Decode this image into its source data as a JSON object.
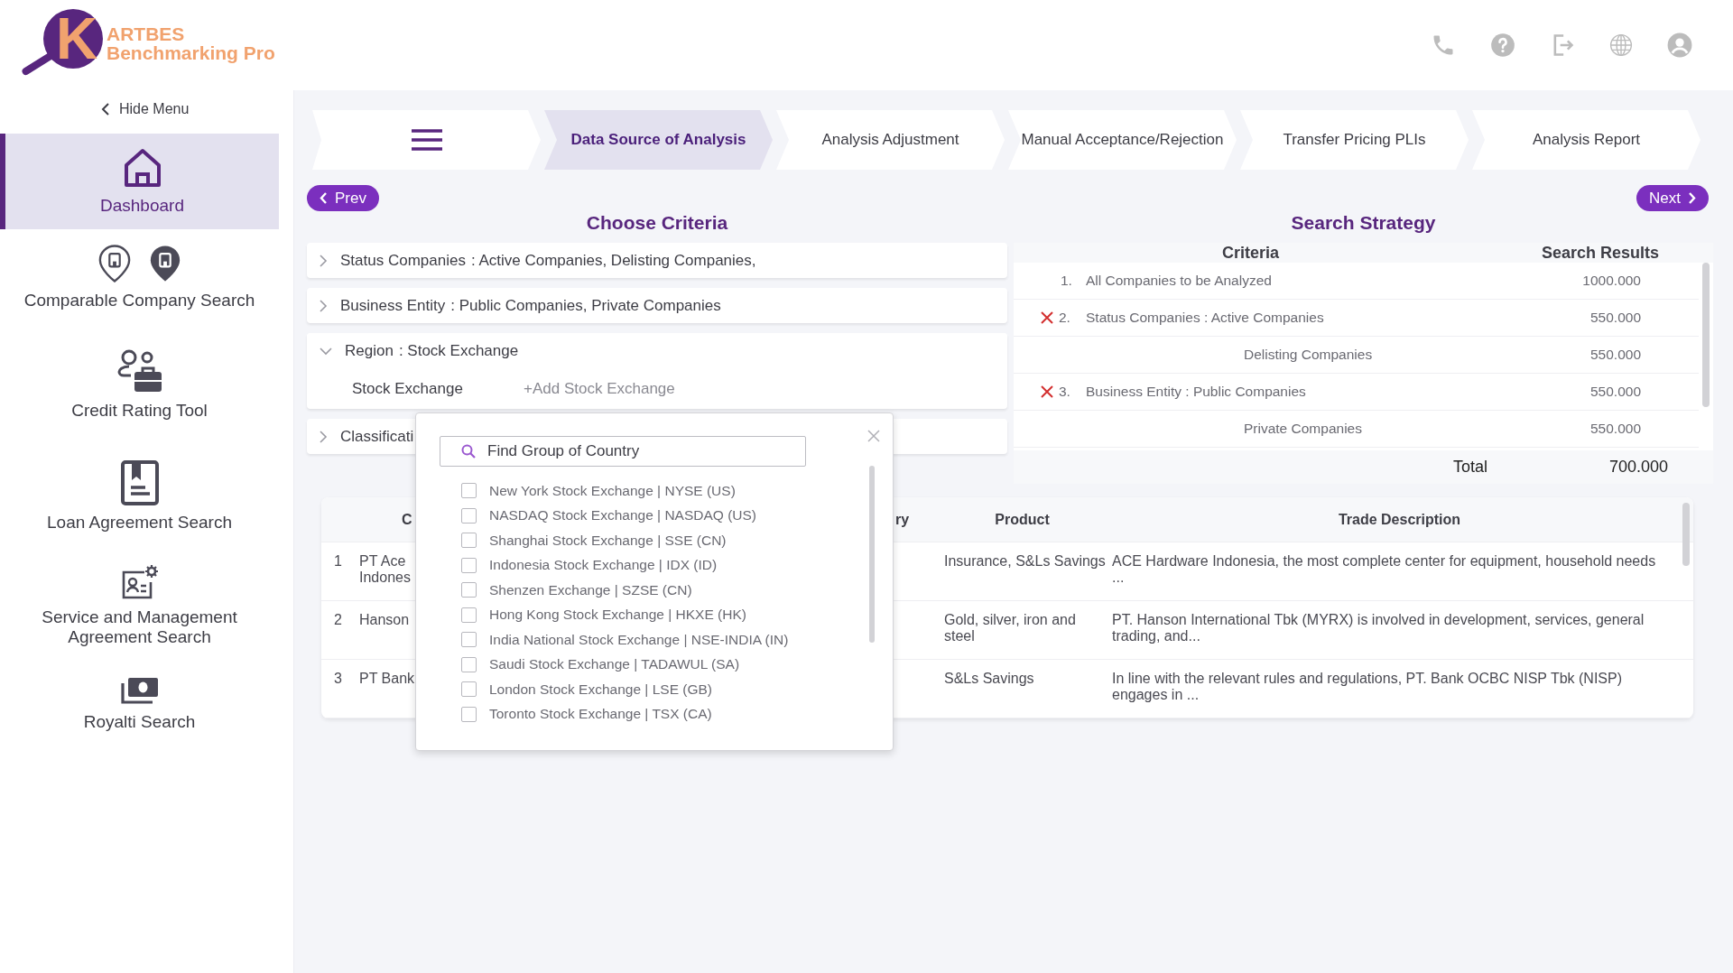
{
  "logo": {
    "mark": "K",
    "name": "ARTBES",
    "subtitle": "Benchmarking Pro"
  },
  "header_icons": [
    {
      "kind": "phone"
    },
    {
      "kind": "help"
    },
    {
      "kind": "logout"
    },
    {
      "kind": "globe"
    },
    {
      "kind": "user"
    }
  ],
  "sidebar": {
    "hide_menu": "Hide Menu",
    "items": [
      {
        "label": "Dashboard",
        "kind": "home",
        "selected": true
      },
      {
        "label": "Comparable Company Search",
        "kind": "pins",
        "selected": false
      },
      {
        "label": "Credit Rating Tool",
        "kind": "person-briefcase",
        "selected": false
      },
      {
        "label": "Loan Agreement Search",
        "kind": "document",
        "selected": false
      },
      {
        "label": "Service and Management Agreement Search",
        "kind": "profile-gear",
        "selected": false
      },
      {
        "label": "Royalti Search",
        "kind": "cash",
        "selected": false
      }
    ]
  },
  "tabs": [
    {
      "kind": "menu",
      "selected": false
    },
    {
      "kind": "step",
      "label": "Data Source of Analysis",
      "selected": true
    },
    {
      "kind": "step",
      "label": "Analysis Adjustment",
      "selected": false
    },
    {
      "kind": "step",
      "label": "Manual Acceptance/Rejection",
      "selected": false
    },
    {
      "kind": "step",
      "label": "Transfer Pricing PLIs",
      "selected": false
    },
    {
      "kind": "step",
      "label": "Analysis Report",
      "selected": false
    }
  ],
  "prev_button": "Prev",
  "next_button": "Next",
  "criteria": {
    "title": "Choose Criteria",
    "rows": [
      {
        "label": "Status Companies",
        "value": ": Active Companies,  Delisting Companies,",
        "expanded": false
      },
      {
        "label": "Business Entity",
        "value": ": Public Companies,  Private Companies",
        "expanded": false
      },
      {
        "label": "Region",
        "value": ": Stock Exchange",
        "expanded": true,
        "children": [
          {
            "label": "Stock Exchange",
            "action": "+Add Stock Exchange"
          }
        ]
      },
      {
        "label": "Classificati",
        "expanded": false
      }
    ]
  },
  "strategy": {
    "title": "Search Strategy",
    "columns": [
      "Criteria",
      "Search Results"
    ],
    "rows": [
      {
        "number": "1.",
        "criteria": "All Companies to be Analyzed",
        "result": "1000.000",
        "removable": false
      },
      {
        "number": "2.",
        "criteria": "Status Companies : Active Companies",
        "result": "550.000",
        "removable": true
      },
      {
        "criteria": "Delisting Companies",
        "result": "550.000",
        "removable": false
      },
      {
        "number": "3.",
        "criteria": "Business Entity : Public Companies",
        "result": "550.000",
        "removable": true
      },
      {
        "criteria": "Private Companies",
        "result": "550.000",
        "removable": false
      }
    ],
    "total_label": "Total",
    "total": "700.000"
  },
  "companies": {
    "columns": [
      "C",
      "ry",
      "Product",
      "Trade Description"
    ],
    "rows": [
      {
        "number": "1",
        "company": "PT Ace\nIndones",
        "product": "Insurance, S&Ls Savings",
        "trade_description": "ACE Hardware Indonesia, the most complete center for equipment, household needs ..."
      },
      {
        "number": "2",
        "company": "Hanson",
        "product": "Gold, silver, iron and steel",
        "trade_description": "PT. Hanson International Tbk (MYRX) is involved in development, services, general trading, and..."
      },
      {
        "number": "3",
        "company": "PT Bank",
        "product": "S&Ls Savings",
        "trade_description": "In line with the relevant rules and regulations, PT. Bank OCBC NISP Tbk (NISP) engages in ..."
      }
    ]
  },
  "exchange_popup": {
    "search": {
      "placeholder": "Find Group of Country"
    },
    "options": [
      {
        "label": "New York Stock Exchange | NYSE (US)",
        "checked": false
      },
      {
        "label": "NASDAQ Stock Exchange | NASDAQ (US)",
        "checked": false
      },
      {
        "label": "Shanghai Stock Exchange | SSE (CN)",
        "checked": false
      },
      {
        "label": "Indonesia Stock Exchange | IDX (ID)",
        "checked": false
      },
      {
        "label": "Shenzen Exchange | SZSE (CN)",
        "checked": false
      },
      {
        "label": "Hong Kong Stock Exchange | HKXE (HK)",
        "checked": false
      },
      {
        "label": "India National Stock Exchange | NSE-INDIA (IN)",
        "checked": false
      },
      {
        "label": "Saudi Stock Exchange | TADAWUL (SA)",
        "checked": false
      },
      {
        "label": "London Stock Exchange | LSE (GB)",
        "checked": false
      },
      {
        "label": "Toronto Stock Exchange | TSX (CA)",
        "checked": false
      }
    ]
  }
}
